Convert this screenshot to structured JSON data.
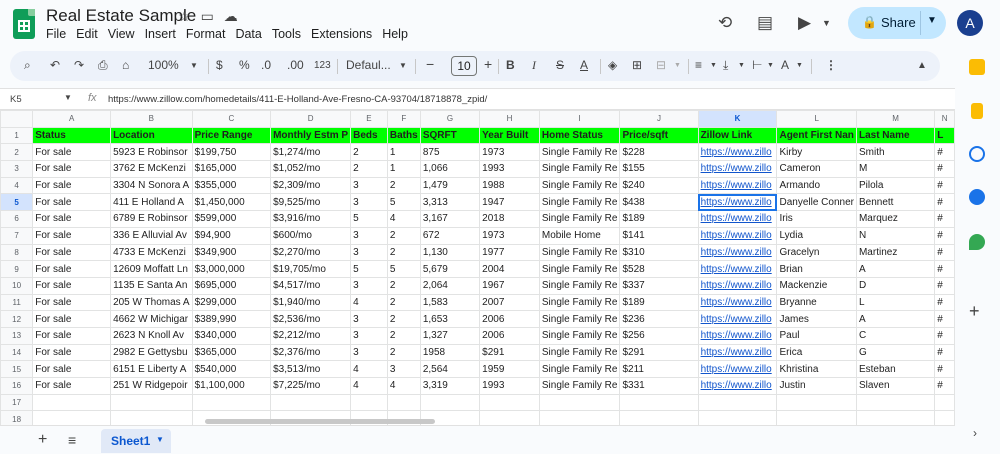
{
  "app": {
    "doc_title": "Real Estate Sample",
    "menu": [
      "File",
      "Edit",
      "View",
      "Insert",
      "Format",
      "Data",
      "Tools",
      "Extensions",
      "Help"
    ],
    "share_label": "Share",
    "avatar_letter": "A"
  },
  "toolbar": {
    "zoom": "100%",
    "currency": "$",
    "percent": "%",
    "dec_decrease": ".0",
    "dec_increase": ".00",
    "number_format": "123",
    "font": "Defaul...",
    "font_size": "10",
    "bold": "B",
    "italic": "I",
    "strike": "S",
    "text_color": "A"
  },
  "formula_bar": {
    "name_box": "K5",
    "fx": "fx",
    "value": "https://www.zillow.com/homedetails/411-E-Holland-Ave-Fresno-CA-93704/18718878_zpid/"
  },
  "grid": {
    "columns": [
      "A",
      "B",
      "C",
      "D",
      "E",
      "F",
      "G",
      "H",
      "I",
      "J",
      "K",
      "L",
      "M",
      "N"
    ],
    "selected_column": "K",
    "selected_row": "5",
    "header_row": [
      "Status",
      "Location",
      "Price Range",
      "Monthly Estm P",
      "Beds",
      "Baths",
      "SQRFT",
      "Year Built",
      "Home Status",
      "Price/sqft",
      "Zillow Link",
      "Agent First Nan",
      "Last Name",
      "L"
    ],
    "rows": [
      [
        "For sale",
        "5923 E Robinsor",
        "$199,750",
        "$1,274/mo",
        "2",
        "1",
        "875",
        "1973",
        "Single Family Re",
        "$228",
        "https://www.zillo",
        "Kirby",
        "Smith",
        "#"
      ],
      [
        "For sale",
        "3762 E McKenzi",
        "$165,000",
        "$1,052/mo",
        "2",
        "1",
        "1,066",
        "1993",
        "Single Family Re",
        "$155",
        "https://www.zillo",
        "Cameron",
        "M",
        "#"
      ],
      [
        "For sale",
        "3304 N Sonora A",
        "$355,000",
        "$2,309/mo",
        "3",
        "2",
        "1,479",
        "1988",
        "Single Family Re",
        "$240",
        "https://www.zillo",
        "Armando",
        "Pilola",
        "#"
      ],
      [
        "For sale",
        "411 E Holland A",
        "$1,450,000",
        "$9,525/mo",
        "3",
        "5",
        "3,313",
        "1947",
        "Single Family Re",
        "$438",
        "https://www.zillo",
        "Danyelle Conner",
        "Bennett",
        "#"
      ],
      [
        "For sale",
        "6789 E Robinsor",
        "$599,000",
        "$3,916/mo",
        "5",
        "4",
        "3,167",
        "2018",
        "Single Family Re",
        "$189",
        "https://www.zillo",
        "Iris",
        "Marquez",
        "#"
      ],
      [
        "For sale",
        "336 E Alluvial Av",
        "$94,900",
        "$600/mo",
        "3",
        "2",
        "672",
        "1973",
        "Mobile Home",
        "$141",
        "https://www.zillo",
        "Lydia",
        "N",
        "#"
      ],
      [
        "For sale",
        "4733 E McKenzi",
        "$349,900",
        "$2,270/mo",
        "3",
        "2",
        "1,130",
        "1977",
        "Single Family Re",
        "$310",
        "https://www.zillo",
        "Gracelyn",
        "Martinez",
        "#"
      ],
      [
        "For sale",
        "12609 Moffatt Ln",
        "$3,000,000",
        "$19,705/mo",
        "5",
        "5",
        "5,679",
        "2004",
        "Single Family Re",
        "$528",
        "https://www.zillo",
        "Brian",
        "A",
        "#"
      ],
      [
        "For sale",
        "1135 E Santa An",
        "$695,000",
        "$4,517/mo",
        "3",
        "2",
        "2,064",
        "1967",
        "Single Family Re",
        "$337",
        "https://www.zillo",
        "Mackenzie",
        "D",
        "#"
      ],
      [
        "For sale",
        "205 W Thomas A",
        "$299,000",
        "$1,940/mo",
        "4",
        "2",
        "1,583",
        "2007",
        "Single Family Re",
        "$189",
        "https://www.zillo",
        "Bryanne",
        "L",
        "#"
      ],
      [
        "For sale",
        "4662 W Michigar",
        "$389,990",
        "$2,536/mo",
        "3",
        "2",
        "1,653",
        "2006",
        "Single Family Re",
        "$236",
        "https://www.zillo",
        "James",
        "A",
        "#"
      ],
      [
        "For sale",
        "2623 N Knoll Av",
        "$340,000",
        "$2,212/mo",
        "3",
        "2",
        "1,327",
        "2006",
        "Single Family Re",
        "$256",
        "https://www.zillo",
        "Paul",
        "C",
        "#"
      ],
      [
        "For sale",
        "2982 E Gettysbu",
        "$365,000",
        "$2,376/mo",
        "3",
        "2",
        "1958",
        "$291",
        "Single Family Re",
        "$291",
        "https://www.zillo",
        "Erica",
        "G",
        "#"
      ],
      [
        "For sale",
        "6151 E Liberty A",
        "$540,000",
        "$3,513/mo",
        "4",
        "3",
        "2,564",
        "1959",
        "Single Family Re",
        "$211",
        "https://www.zillo",
        "Khristina",
        "Esteban",
        "#"
      ],
      [
        "For sale",
        "251 W Ridgepoir",
        "$1,100,000",
        "$7,225/mo",
        "4",
        "4",
        "3,319",
        "1993",
        "Single Family Re",
        "$331",
        "https://www.zillo",
        "Justin",
        "Slaven",
        "#"
      ],
      [
        "",
        "",
        "",
        "",
        "",
        "",
        "",
        "",
        "",
        "",
        "",
        "",
        "",
        ""
      ],
      [
        "",
        "",
        "",
        "",
        "",
        "",
        "",
        "",
        "",
        "",
        "",
        "",
        "",
        ""
      ]
    ]
  },
  "sheet_tabs": {
    "active": "Sheet1"
  },
  "colors": {
    "header_fill": "#00ff00",
    "accent": "#0b57d0",
    "share_bg": "#c2e7ff"
  }
}
